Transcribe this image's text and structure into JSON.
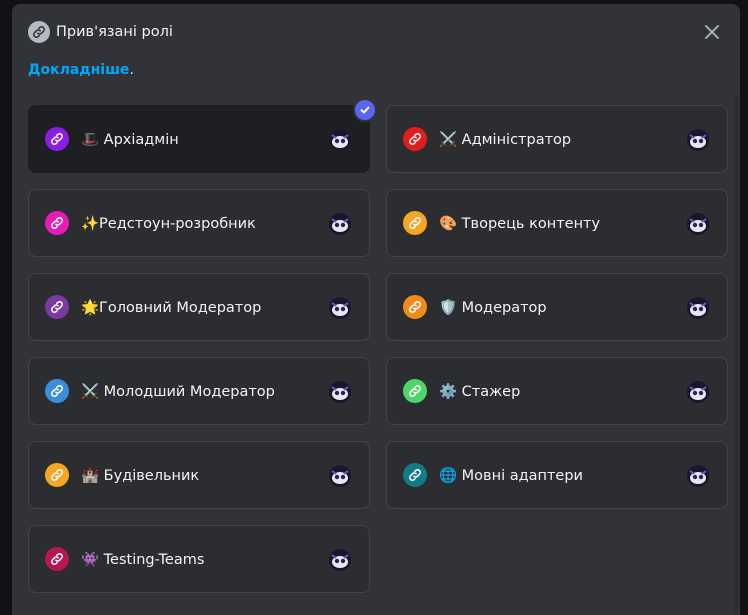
{
  "header": {
    "title": "Прив'язані ролі",
    "learn_more": "Докладніше",
    "learn_more_suffix": "."
  },
  "roles": [
    {
      "label": "🎩 Архіадмін",
      "color": "#8b1ce6",
      "selected": true
    },
    {
      "label": "⚔️ Адміністратор",
      "color": "#e41c1c",
      "selected": false
    },
    {
      "label": "✨Редстоун-розробник",
      "color": "#e61cb8",
      "selected": false
    },
    {
      "label": "🎨 Творець контенту",
      "color": "#f5a623",
      "selected": false
    },
    {
      "label": "🌟Головний Модератор",
      "color": "#7b3aa0",
      "selected": false
    },
    {
      "label": "🛡️ Модератор",
      "color": "#f08c1c",
      "selected": false
    },
    {
      "label": "⚔️ Молодший Модератор",
      "color": "#3a8fd8",
      "selected": false
    },
    {
      "label": "⚙️ Стажер",
      "color": "#4fd66a",
      "selected": false
    },
    {
      "label": "🏰 Будівельник",
      "color": "#f5a623",
      "selected": false
    },
    {
      "label": "🌐 Мовні адаптери",
      "color": "#137a86",
      "selected": false
    },
    {
      "label": "👾 Testing-Teams",
      "color": "#b8164e",
      "selected": false
    }
  ]
}
